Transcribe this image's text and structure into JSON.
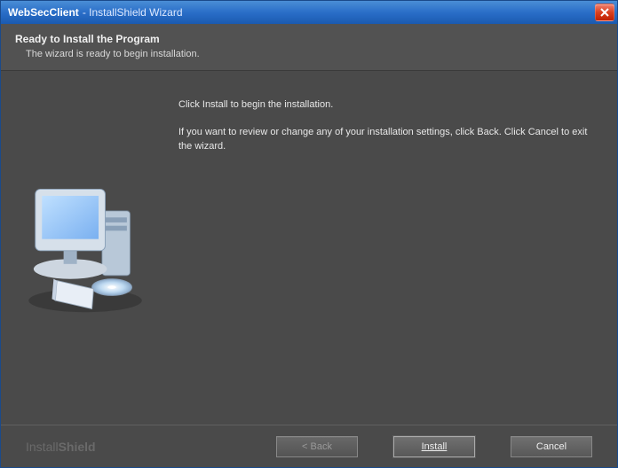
{
  "window": {
    "title_strong": "WebSecClient",
    "title_rest": "- InstallShield Wizard"
  },
  "header": {
    "title": "Ready to Install the Program",
    "subtitle": "The wizard is ready to begin installation."
  },
  "content": {
    "line1": "Click Install to begin the installation.",
    "line2": "If you want to review or change any of your installation settings, click Back. Click Cancel to exit the wizard."
  },
  "brand": {
    "part1": "Install",
    "part2": "Shield"
  },
  "buttons": {
    "back": "< Back",
    "install": "Install",
    "cancel": "Cancel"
  }
}
